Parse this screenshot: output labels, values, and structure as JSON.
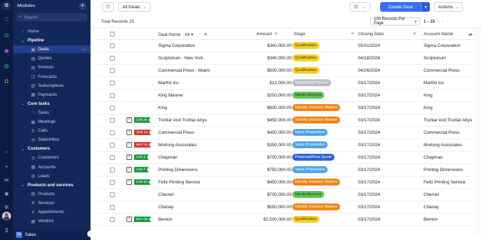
{
  "sidebar": {
    "title": "Modules",
    "search_placeholder": "Search",
    "items": [
      {
        "label": "Home",
        "icon": "home-icon",
        "glyph": "⌂",
        "indent": 1,
        "type": "item"
      },
      {
        "label": "Pipeline",
        "icon": "chevron-down-icon",
        "glyph": "⌄",
        "indent": 1,
        "type": "section"
      },
      {
        "label": "Deals",
        "icon": "deals-icon",
        "glyph": "▣",
        "indent": 2,
        "type": "active"
      },
      {
        "label": "Quotes",
        "icon": "quotes-icon",
        "glyph": "▤",
        "indent": 2,
        "type": "item"
      },
      {
        "label": "Invoices",
        "icon": "invoices-icon",
        "glyph": "▤",
        "indent": 2,
        "type": "item"
      },
      {
        "label": "Forecasts",
        "icon": "forecasts-icon",
        "glyph": "◫",
        "indent": 2,
        "type": "item"
      },
      {
        "label": "Subscriptions",
        "icon": "subscriptions-icon",
        "glyph": "▥",
        "indent": 2,
        "type": "item"
      },
      {
        "label": "Payments",
        "icon": "payments-icon",
        "glyph": "▦",
        "indent": 2,
        "type": "item"
      },
      {
        "label": "Core tasks",
        "icon": "chevron-down-icon",
        "glyph": "⌄",
        "indent": 1,
        "type": "section"
      },
      {
        "label": "Tasks",
        "icon": "tasks-icon",
        "glyph": "◌",
        "indent": 2,
        "type": "item"
      },
      {
        "label": "Meetings",
        "icon": "meetings-icon",
        "glyph": "▦",
        "indent": 2,
        "type": "item"
      },
      {
        "label": "Calls",
        "icon": "phone-icon",
        "glyph": "✆",
        "indent": 2,
        "type": "item"
      },
      {
        "label": "SalesInbox",
        "icon": "mail-icon",
        "glyph": "✉",
        "indent": 2,
        "type": "item"
      },
      {
        "label": "Customers",
        "icon": "chevron-down-icon",
        "glyph": "⌄",
        "indent": 1,
        "type": "section"
      },
      {
        "label": "Customers",
        "icon": "customers-icon",
        "glyph": "◎",
        "indent": 2,
        "type": "item"
      },
      {
        "label": "Accounts",
        "icon": "accounts-icon",
        "glyph": "▦",
        "indent": 2,
        "type": "item"
      },
      {
        "label": "Leads",
        "icon": "leads-icon",
        "glyph": "◍",
        "indent": 2,
        "type": "item"
      },
      {
        "label": "Products and services",
        "icon": "chevron-down-icon",
        "glyph": "⌄",
        "indent": 1,
        "type": "section"
      },
      {
        "label": "Products",
        "icon": "products-icon",
        "glyph": "▤",
        "indent": 2,
        "type": "item"
      },
      {
        "label": "Services",
        "icon": "services-icon",
        "glyph": "⚙",
        "indent": 2,
        "type": "item"
      },
      {
        "label": "Appointments",
        "icon": "appointments-icon",
        "glyph": "⚘",
        "indent": 2,
        "type": "item"
      },
      {
        "label": "Vendors",
        "icon": "vendors-icon",
        "glyph": "▦",
        "indent": 2,
        "type": "item"
      }
    ],
    "footer": {
      "app_badge": "Sa",
      "label": "Sales"
    }
  },
  "toolbar": {
    "filter_icon": "filter-icon",
    "view_label": "All Deals",
    "create_label": "Create Deal",
    "actions_label": "Actions"
  },
  "subbar": {
    "total_records": "Total Records 15",
    "per_page": "100 Records Per Page",
    "page_range": "1 - 15"
  },
  "table": {
    "headers": {
      "deal_name": "Deal Name",
      "deal_filter": "All",
      "amount": "Amount",
      "stage": "Stage",
      "closing_date": "Closing Date",
      "account_name": "Account Name"
    },
    "rows": [
      {
        "deal": "Sigma Corporation",
        "amount": "$340,000.00",
        "stage": "Qualification",
        "stage_class": "s-qual",
        "date": "05/31/2024",
        "account": "Sigma Corporation",
        "due": "",
        "due_color": ""
      },
      {
        "deal": "Scriptorium - New York",
        "amount": "$340,000.00",
        "stage": "Qualification",
        "stage_class": "s-qual",
        "date": "04/18/2024",
        "account": "Scriptorium",
        "due": "",
        "due_color": ""
      },
      {
        "deal": "Commercial Press - Miami",
        "amount": "$500,000.00",
        "stage": "Qualification",
        "stage_class": "s-qual",
        "date": "04/26/2024",
        "account": "Commercial Press",
        "due": "",
        "due_color": ""
      },
      {
        "deal": "Marthil Inc",
        "amount": "$12,000.00",
        "stage": "Negotiation/Review",
        "stage_class": "s-nego",
        "date": "03/17/2024",
        "account": "Marthil Inc",
        "due": "",
        "due_color": ""
      },
      {
        "deal": "King Manner",
        "amount": "$250,000.00",
        "stage": "Needs Analysis",
        "stage_class": "s-needs",
        "date": "03/17/2024",
        "account": "King",
        "due": "",
        "due_color": ""
      },
      {
        "deal": "King",
        "amount": "$600,000.00",
        "stage": "Identify Decision Makers",
        "stage_class": "s-ident",
        "date": "03/17/2024",
        "account": "King",
        "due": "",
        "due_color": ""
      },
      {
        "deal": "Truhlar And Truhlar Attys",
        "amount": "$450,000.00",
        "stage": "Identify Decision Makers",
        "stage_class": "s-ident",
        "date": "03/17/2024",
        "account": "Truhlar And Truhlar Attys",
        "due": "JUN 25",
        "due_color": "green"
      },
      {
        "deal": "Commercial Press",
        "amount": "$450,000.00",
        "stage": "Value Proposition",
        "stage_class": "s-value",
        "date": "03/17/2024",
        "account": "Commercial Press",
        "due": "APR 16",
        "due_color": "red"
      },
      {
        "deal": "Morlong Associates",
        "amount": "$350,000.00",
        "stage": "Value Proposition",
        "stage_class": "s-value",
        "date": "03/17/2024",
        "account": "Morlong Associates",
        "due": "MAY 16",
        "due_color": "red"
      },
      {
        "deal": "Chapman",
        "amount": "$700,000.00",
        "stage": "Proposal/Price Quote",
        "stage_class": "s-prop",
        "date": "03/17/2024",
        "account": "Chapman",
        "due": "JUN 4",
        "due_color": "green"
      },
      {
        "deal": "Printing Dimensions",
        "amount": "$750,000.00",
        "stage": "Value Proposition",
        "stage_class": "s-value",
        "date": "03/17/2024",
        "account": "Printing Dimensions",
        "due": "JUN 7",
        "due_color": "green"
      },
      {
        "deal": "Feltz Printing Service",
        "amount": "$450,000.00",
        "stage": "Identify Decision Makers",
        "stage_class": "s-ident",
        "date": "03/17/2024",
        "account": "Feltz Printing Service",
        "due": "JUN 30",
        "due_color": "green"
      },
      {
        "deal": "Chemel",
        "amount": "$700,000.00",
        "stage": "Needs Analysis",
        "stage_class": "s-needs",
        "date": "03/17/2024",
        "account": "Chemel",
        "due": "",
        "due_color": ""
      },
      {
        "deal": "Chanay",
        "amount": "$550,000.00",
        "stage": "Identify Decision Makers",
        "stage_class": "s-ident",
        "date": "03/17/2024",
        "account": "Chanay",
        "due": "",
        "due_color": ""
      },
      {
        "deal": "Benton",
        "amount": "$2,500,000.00",
        "stage": "Qualification",
        "stage_class": "s-qual",
        "date": "03/17/2024",
        "account": "Benton",
        "due": "MAY 25",
        "due_color": "green"
      }
    ]
  },
  "rail_icons": [
    {
      "name": "home-rail-icon",
      "glyph": "□",
      "color": "#6fa0ff"
    },
    {
      "name": "activity-rail-icon",
      "glyph": "◎",
      "color": "#2fbf71"
    },
    {
      "name": "target-rail-icon",
      "glyph": "◉",
      "color": "#b266e0"
    },
    {
      "name": "chart-rail-icon",
      "glyph": "◍",
      "color": "#2fbf71"
    },
    {
      "name": "bag-rail-icon",
      "glyph": "◘",
      "color": "#f2b233"
    },
    {
      "name": "search-rail-icon",
      "glyph": "◌",
      "color": "#e0428d"
    },
    {
      "name": "doc-rail-icon",
      "glyph": "▫",
      "color": "#9aa7cc"
    },
    {
      "name": "calendar-rail-icon",
      "glyph": "▪",
      "color": "#9aa7cc"
    },
    {
      "name": "mail-rail-icon",
      "glyph": "✉",
      "color": "#9aa7cc"
    },
    {
      "name": "cog-rail-icon",
      "glyph": "✱",
      "color": "#9aa7cc"
    },
    {
      "name": "support-rail-icon",
      "glyph": "✲",
      "color": "#9aa7cc"
    }
  ]
}
